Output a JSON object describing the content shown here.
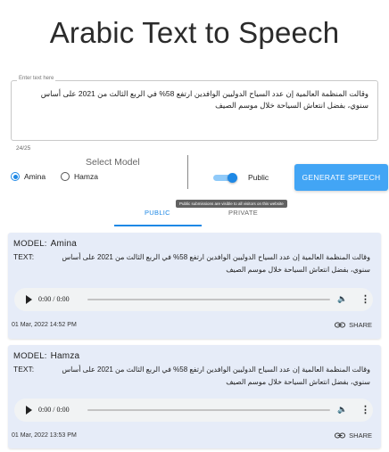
{
  "header": {
    "title": "Arabic Text to Speech"
  },
  "input": {
    "label": "Enter text here",
    "value": "وقالت المنظمة العالمية إن عدد السياح الدوليين الوافدين ارتفع 58% في الربع الثالث من 2021 على أساس سنوي، بفضل انتعاش السياحة خلال موسم الصيف",
    "counter": "24/25"
  },
  "model_select": {
    "title": "Select Model",
    "options": [
      {
        "label": "Amina",
        "selected": true
      },
      {
        "label": "Hamza",
        "selected": false
      }
    ]
  },
  "visibility": {
    "label": "Public",
    "enabled": true
  },
  "generate_button": {
    "label": "GENERATE SPEECH"
  },
  "tooltip": {
    "text": "Public submissions are visible to all visitors on this website"
  },
  "tabs": [
    {
      "label": "PUBLIC",
      "active": true
    },
    {
      "label": "PRIVATE",
      "active": false
    }
  ],
  "results": [
    {
      "model_label": "MODEL:",
      "model_name": "Amina",
      "text_label": "TEXT:",
      "text": "وقالت المنظمة العالمية إن عدد السياح الدوليين الوافدين ارتفع 58% في الربع الثالث من 2021 على أساس سنوي، بفضل انتعاش السياحة خلال موسم الصيف",
      "audio_time": "0:00 / 0:00",
      "date": "01 Mar, 2022 14:52 PM",
      "share_label": "SHARE"
    },
    {
      "model_label": "MODEL:",
      "model_name": "Hamza",
      "text_label": "TEXT:",
      "text": "وقالت المنظمة العالمية إن عدد السياح الدوليين الوافدين ارتفع 58% في الربع الثالث من 2021 على أساس سنوي، بفضل انتعاش السياحة خلال موسم الصيف",
      "audio_time": "0:00 / 0:00",
      "date": "01 Mar, 2022 13:53 PM",
      "share_label": "SHARE"
    }
  ],
  "icons": {
    "play": "play-icon",
    "volume": "volume-icon",
    "more": "more-vert-icon",
    "share": "link-icon"
  },
  "colors": {
    "accent": "#1e88e5",
    "button": "#42a5f5",
    "card_bg": "#e6ecf8"
  }
}
